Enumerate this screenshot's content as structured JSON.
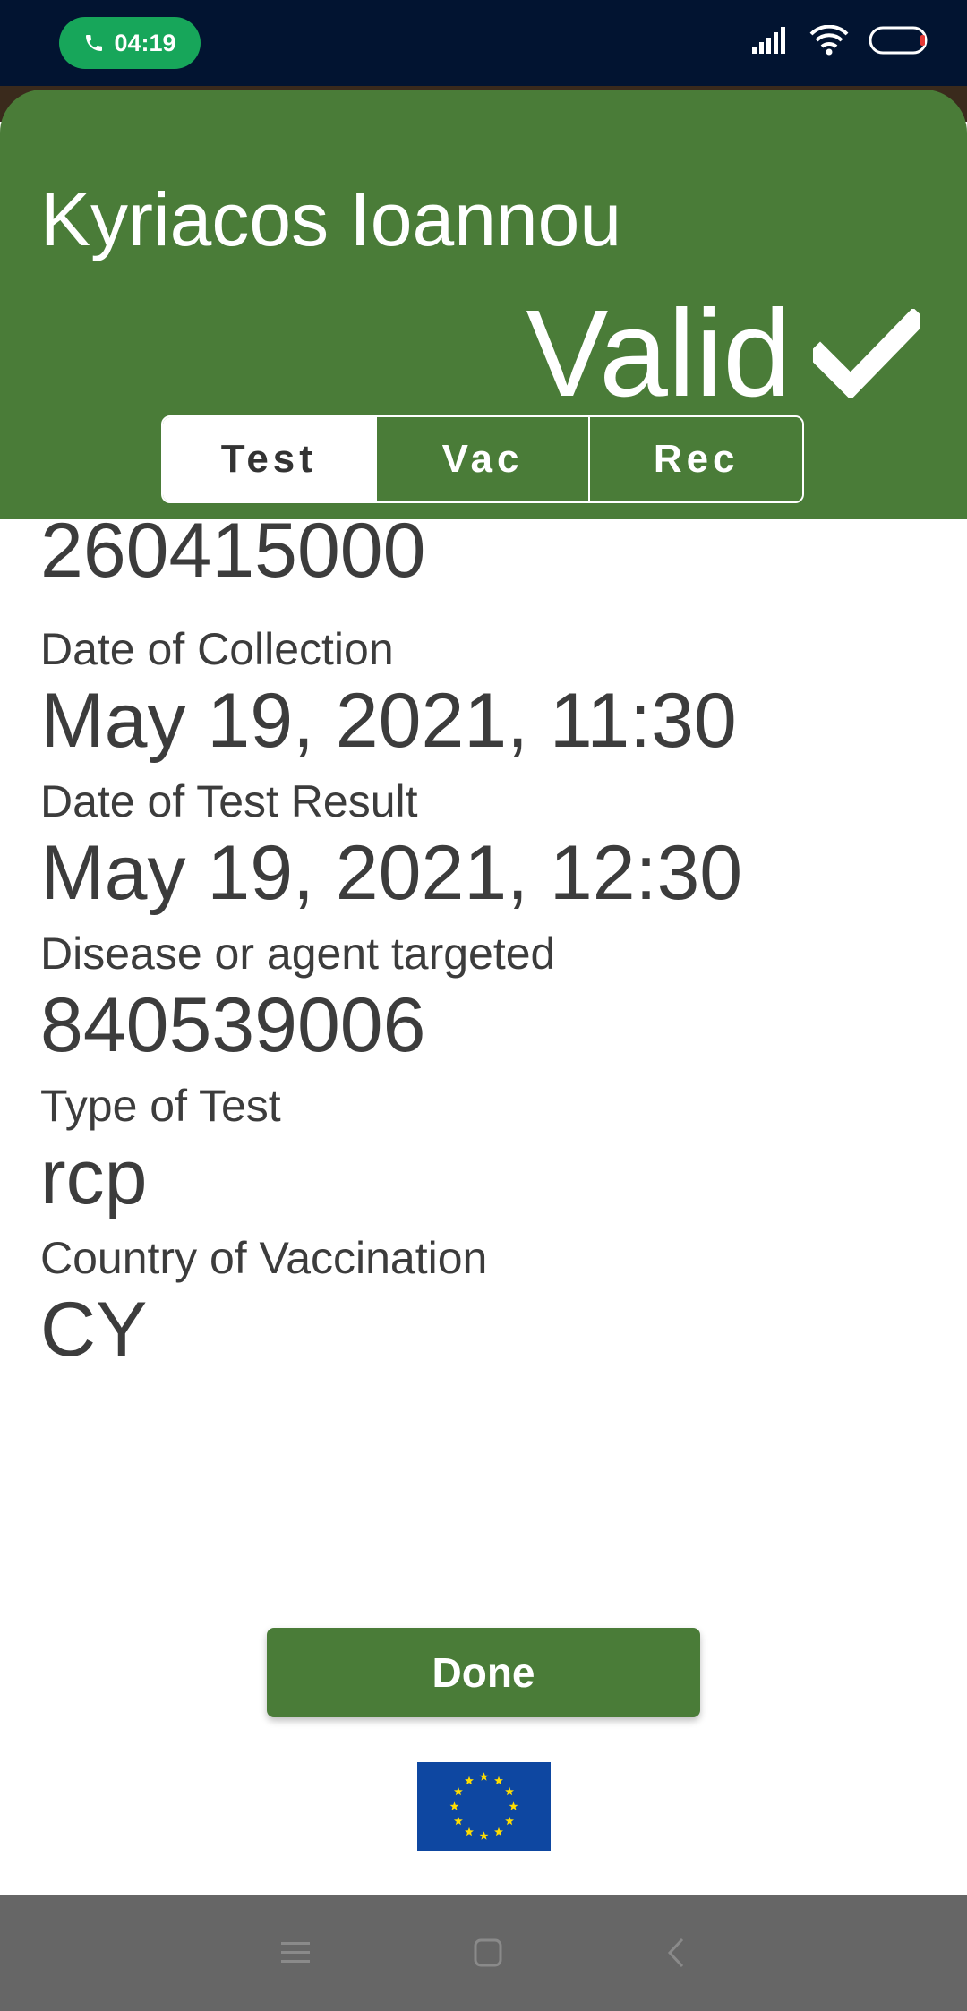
{
  "status_bar": {
    "call_time": "04:19"
  },
  "header": {
    "name": "Kyriacos Ioannou",
    "validity": "Valid",
    "tabs": [
      {
        "label": "Test",
        "active": true
      },
      {
        "label": "Vac",
        "active": false
      },
      {
        "label": "Rec",
        "active": false
      }
    ]
  },
  "details": {
    "partial_value": "260415000",
    "fields": [
      {
        "label": "Date of Collection",
        "value": "May 19, 2021, 11:30"
      },
      {
        "label": "Date of Test Result",
        "value": "May 19, 2021, 12:30"
      },
      {
        "label": "Disease or agent targeted",
        "value": "840539006"
      },
      {
        "label": "Type of Test",
        "value": "rcp"
      },
      {
        "label": "Country of Vaccination",
        "value": "CY"
      }
    ]
  },
  "done_label": "Done",
  "icons": {
    "phone": "phone-icon",
    "signal": "signal-icon",
    "wifi": "wifi-icon",
    "battery": "battery-icon",
    "check": "checkmark-icon",
    "menu": "menu-icon",
    "home": "home-icon",
    "back": "back-icon",
    "flag": "eu-flag-icon"
  },
  "colors": {
    "accent_green": "#4a7c38",
    "status_bar": "#021431",
    "call_pill": "#17a65a",
    "nav_bar": "#666666",
    "eu_blue": "#0e47a1",
    "eu_yellow": "#ffdd00"
  }
}
